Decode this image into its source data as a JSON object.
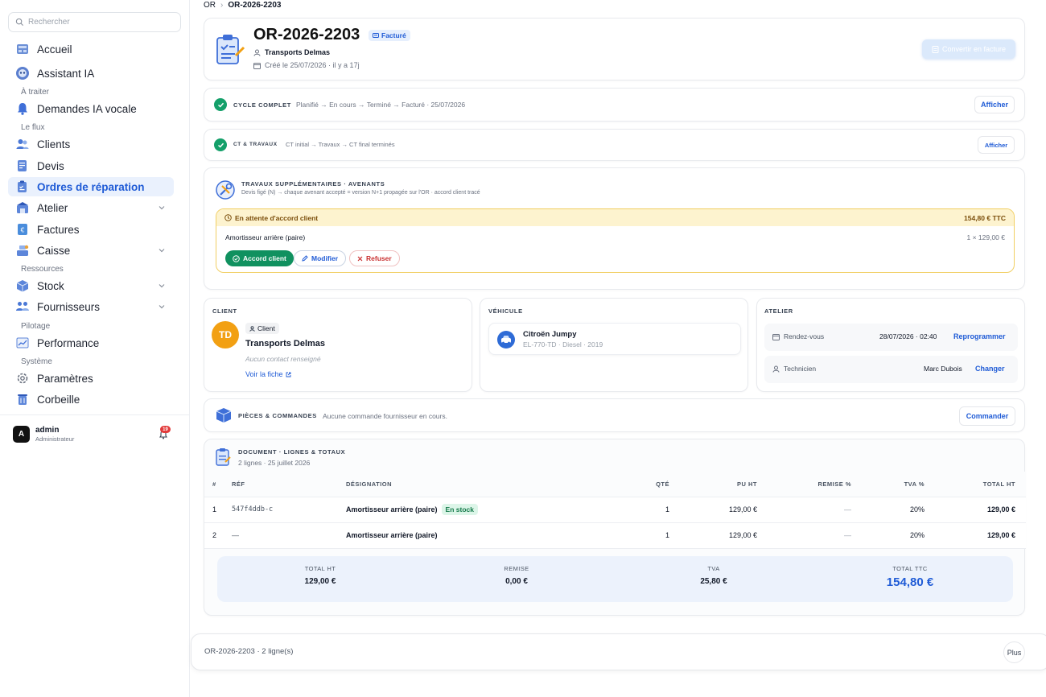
{
  "sidebar": {
    "search_placeholder": "Rechercher",
    "items": [
      {
        "label": "Accueil"
      },
      {
        "label": "Assistant IA"
      },
      {
        "label": "Demandes IA vocale"
      },
      {
        "label": "Clients"
      },
      {
        "label": "Devis"
      },
      {
        "label": "Ordres de réparation"
      },
      {
        "label": "Atelier"
      },
      {
        "label": "Factures"
      },
      {
        "label": "Caisse"
      },
      {
        "label": "Stock"
      },
      {
        "label": "Fournisseurs"
      },
      {
        "label": "Performance"
      },
      {
        "label": "Paramètres"
      },
      {
        "label": "Corbeille"
      }
    ],
    "sections": [
      "À traiter",
      "Le flux",
      "Ressources",
      "Pilotage",
      "Système"
    ],
    "user": {
      "initial": "A",
      "name": "admin",
      "role": "Administrateur",
      "notif_count": "19"
    }
  },
  "breadcrumb": {
    "root": "OR",
    "separator": "›",
    "current": "OR-2026-2203"
  },
  "header": {
    "title": "OR-2026-2203",
    "status": "Facturé",
    "client": "Transports Delmas",
    "created": "Créé le 25/07/2026 · il y a 17j",
    "convert_label": "Convertir en facture"
  },
  "cycle": {
    "title": "CYCLE COMPLET",
    "desc": "Planifié → En cours → Terminé → Facturé · 25/07/2026",
    "action": "Afficher"
  },
  "ct": {
    "title": "CT & TRAVAUX",
    "desc": "CT initial → Travaux → CT final terminés",
    "action": "Afficher"
  },
  "avenants": {
    "title": "TRAVAUX SUPPLÉMENTAIRES · AVENANTS",
    "desc": "Devis figé (N) → chaque avenant accepté = version N+1 propagée sur l'OR · accord client tracé",
    "pending_label": "En attente d'accord client",
    "pending_amount": "154,80 € TTC",
    "item_label": "Amortisseur arrière (paire)",
    "item_qty": "1 × 129,00 €",
    "btn_accept": "Accord client",
    "btn_modify": "Modifier",
    "btn_refuse": "Refuser"
  },
  "client_card": {
    "title": "CLIENT",
    "initials": "TD",
    "tag": "Client",
    "name": "Transports Delmas",
    "contact": "Aucun contact renseigné",
    "link": "Voir la fiche"
  },
  "vehicle_card": {
    "title": "VÉHICULE",
    "model": "Citroën Jumpy",
    "details": "EL-770-TD · Diesel · 2019"
  },
  "atelier_card": {
    "title": "ATELIER",
    "rdv_label": "Rendez-vous",
    "rdv_value": "28/07/2026 · 02:40",
    "rdv_action": "Reprogrammer",
    "tech_label": "Technicien",
    "tech_value": "Marc Dubois",
    "tech_action": "Changer"
  },
  "parts": {
    "title": "PIÈCES & COMMANDES",
    "desc": "Aucune commande fournisseur en cours.",
    "action": "Commander"
  },
  "document": {
    "title": "DOCUMENT · LIGNES & TOTAUX",
    "subtitle": "2 lignes · 25 juillet 2026",
    "columns": [
      "#",
      "RÉF",
      "DÉSIGNATION",
      "QTÉ",
      "PU HT",
      "REMISE %",
      "TVA %",
      "TOTAL HT"
    ],
    "rows": [
      {
        "n": "1",
        "ref": "547f4ddb-c",
        "designation": "Amortisseur arrière (paire)",
        "stock": "En stock",
        "qty": "1",
        "pu": "129,00 €",
        "remise": "—",
        "tva": "20%",
        "total": "129,00 €"
      },
      {
        "n": "2",
        "ref": "—",
        "designation": "Amortisseur arrière (paire)",
        "stock": "",
        "qty": "1",
        "pu": "129,00 €",
        "remise": "—",
        "tva": "20%",
        "total": "129,00 €"
      }
    ],
    "totals": {
      "ht_label": "TOTAL HT",
      "ht": "129,00 €",
      "remise_label": "REMISE",
      "remise": "0,00 €",
      "tva_label": "TVA",
      "tva": "25,80 €",
      "ttc_label": "TOTAL TTC",
      "ttc": "154,80 €"
    }
  },
  "footer": {
    "summary": "OR-2026-2203 · 2 ligne(s)",
    "more": "Plus"
  },
  "colors": {
    "accent": "#1f5bd6",
    "success": "#14a06a",
    "warning_bg": "#fdf3cf",
    "danger": "#e23b3b"
  }
}
